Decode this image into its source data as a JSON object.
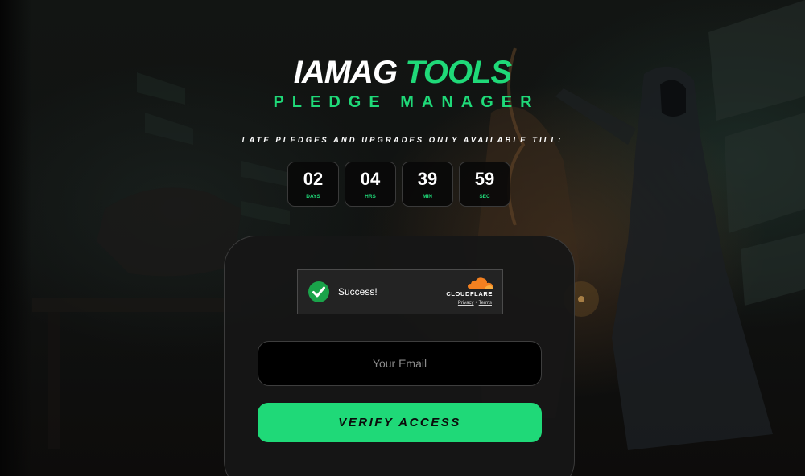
{
  "brand": {
    "part1": "IAMAG",
    "part2": "TOOLS",
    "subtitle": "PLEDGE MANAGER"
  },
  "notice": "LATE PLEDGES AND UPGRADES ONLY AVAILABLE TILL:",
  "countdown": [
    {
      "value": "02",
      "unit": "DAYS"
    },
    {
      "value": "04",
      "unit": "HRS"
    },
    {
      "value": "39",
      "unit": "MIN"
    },
    {
      "value": "59",
      "unit": "SEC"
    }
  ],
  "captcha": {
    "status": "Success!",
    "brand": "CLOUDFLARE",
    "privacy": "Privacy",
    "separator": "•",
    "terms": "Terms"
  },
  "form": {
    "email_placeholder": "Your Email",
    "email_value": "",
    "verify_label": "VERIFY ACCESS"
  },
  "colors": {
    "accent": "#1fd978",
    "background": "#0c0d0c",
    "card": "#161616",
    "captcha_check": "#1aa34a",
    "cloudflare_orange": "#f38020"
  },
  "icons": {
    "captcha_check": "check-circle-icon",
    "cloudflare_logo": "cloudflare-cloud-icon"
  }
}
